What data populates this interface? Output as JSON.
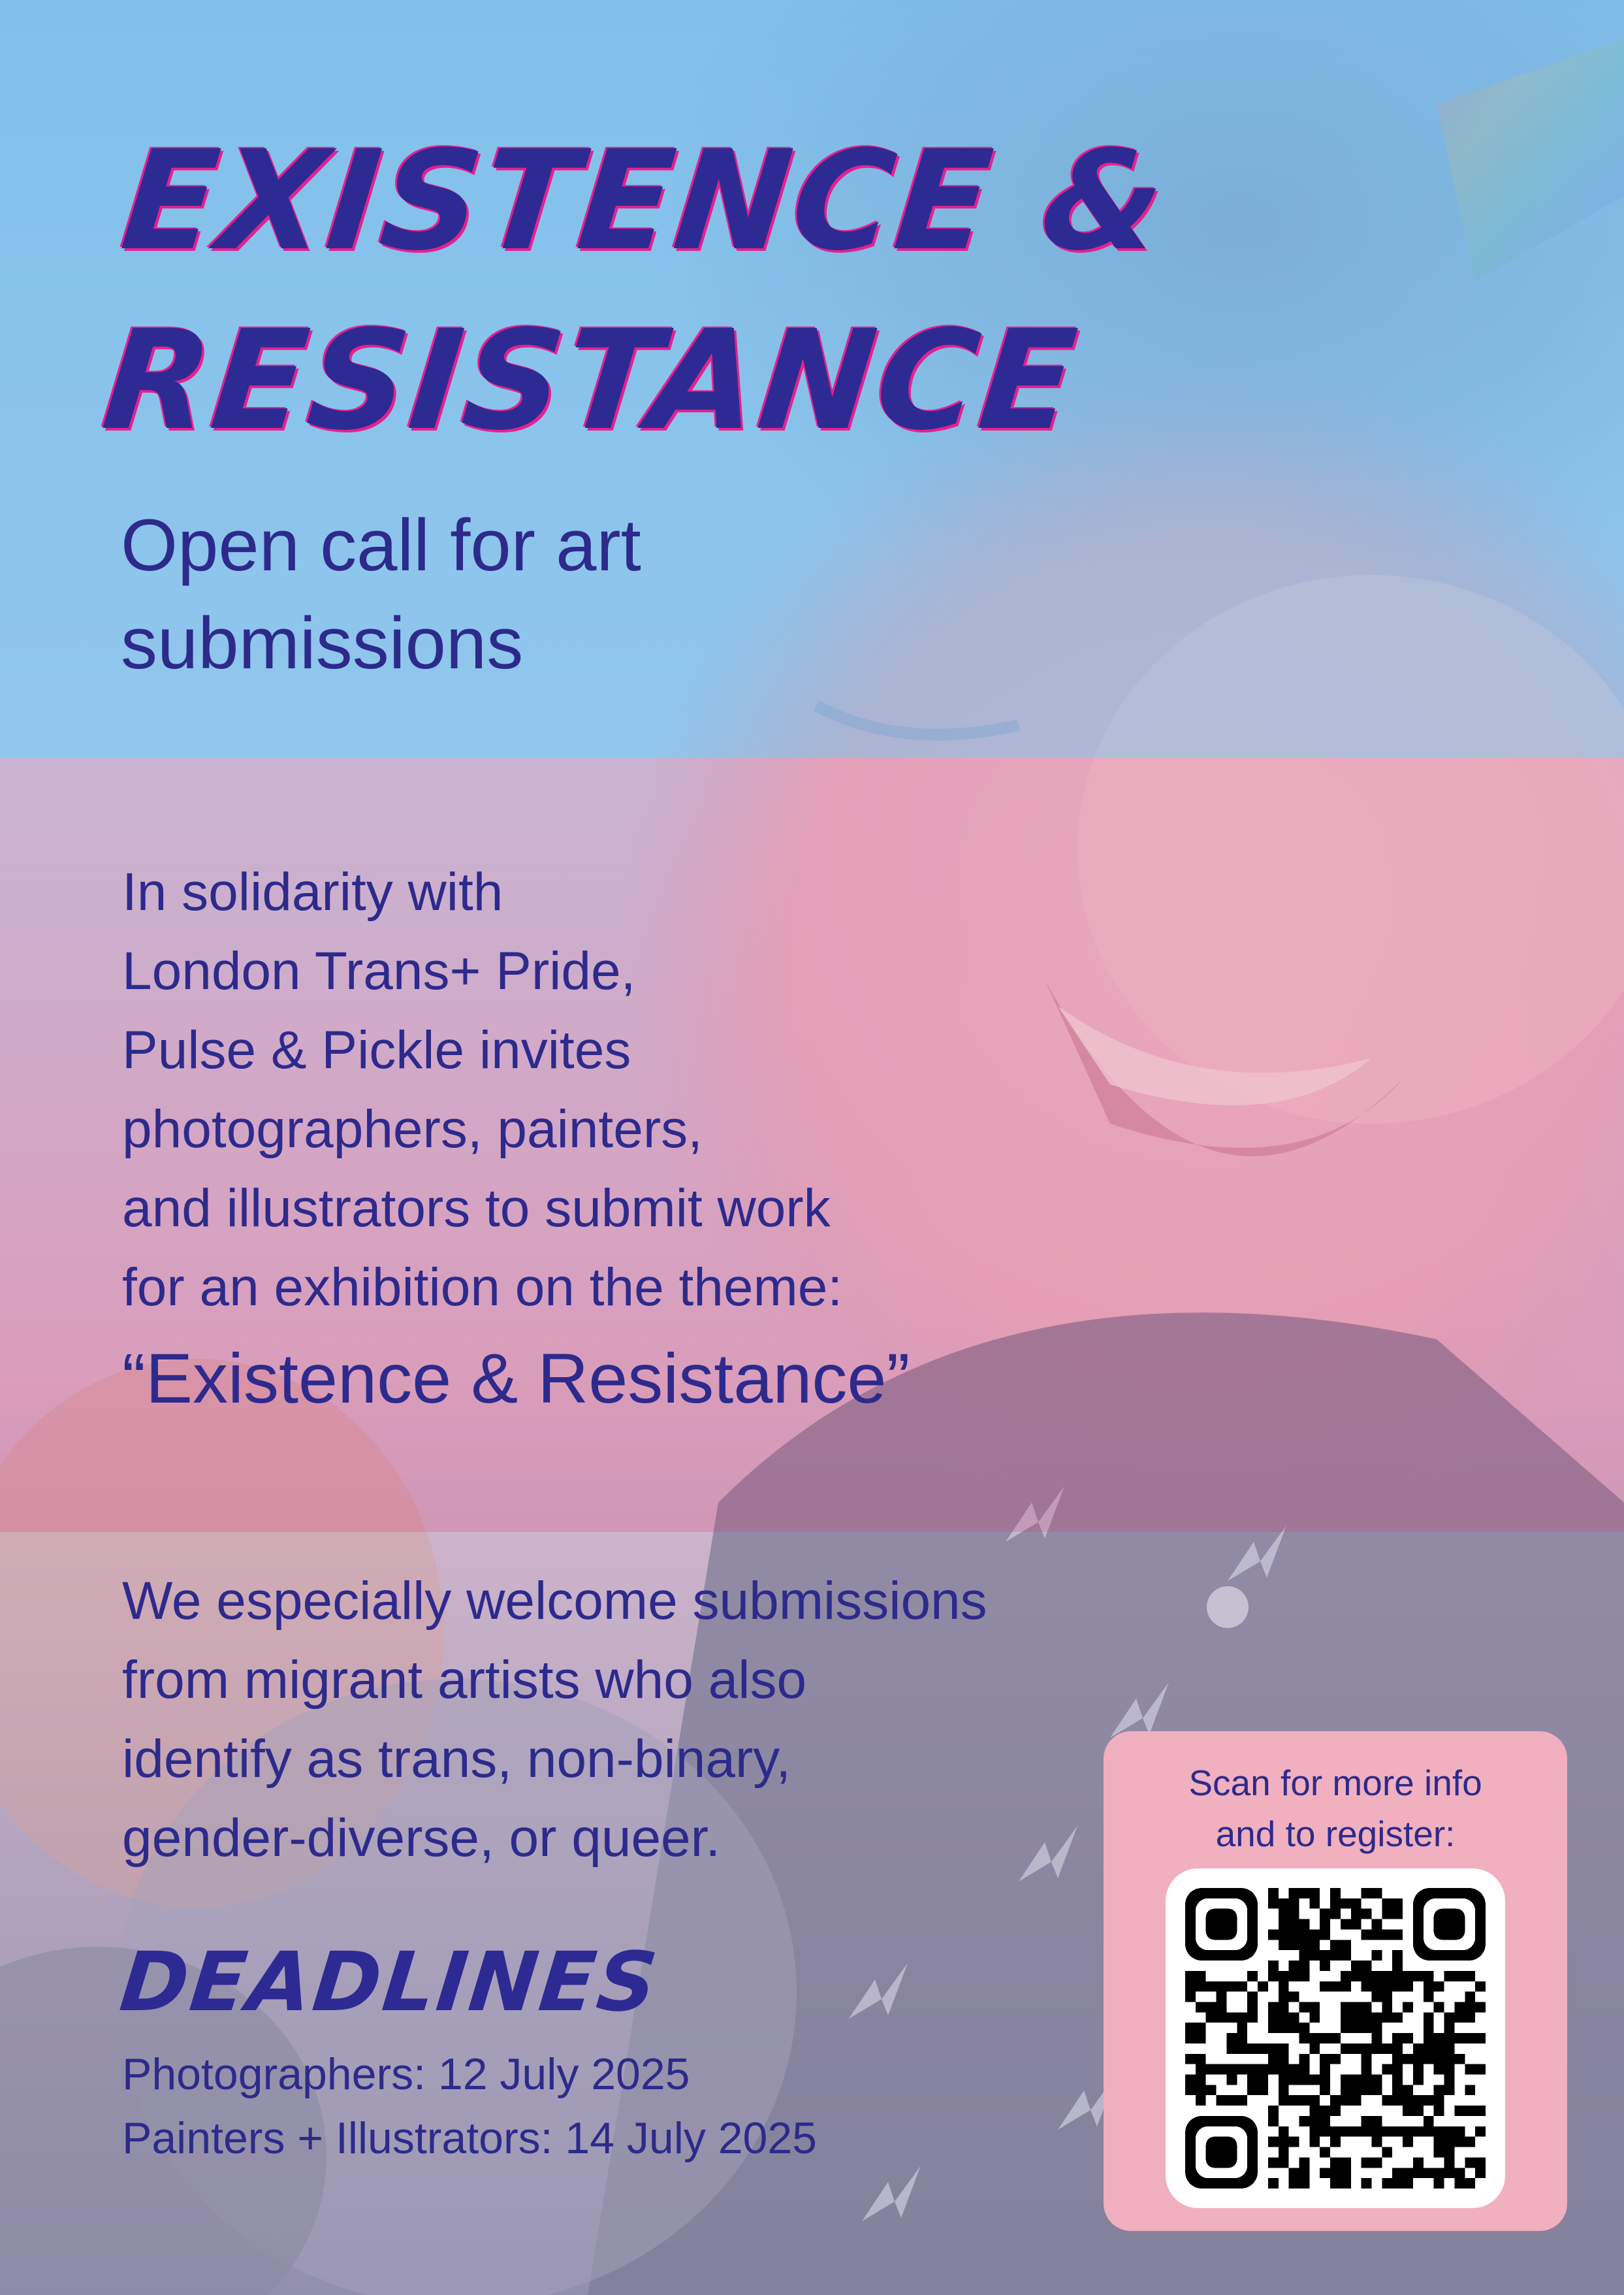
{
  "title": {
    "line1": "Existence &",
    "line2": "Resistance"
  },
  "subtitle": {
    "line1": "Open call for art",
    "line2": "submissions"
  },
  "intro": {
    "lines": [
      "In solidarity with",
      "London Trans+ Pride,",
      "Pulse & Pickle invites",
      "photographers, painters,",
      "and illustrators to submit work",
      "for an exhibition on the theme:"
    ],
    "theme": "“Existence & Resistance”"
  },
  "welcome": {
    "lines": [
      "We especially welcome submissions",
      "from migrant artists who also",
      "identify as trans, non-binary,",
      "gender-diverse, or queer."
    ]
  },
  "deadlines": {
    "heading": "Deadlines",
    "photographers": "Photographers: 12 July 2025",
    "painters": "Painters + Illustrators: 14 July 2025"
  },
  "qr": {
    "caption_line1": "Scan for more info",
    "caption_line2": "and to register:",
    "icon": "qr-code-icon"
  },
  "colors": {
    "ink": "#2d2a8c",
    "accent": "#e6208f",
    "band_blue": "#84c4ee",
    "band_pink": "#e8a0be",
    "card_pink": "#f0b0bf"
  }
}
